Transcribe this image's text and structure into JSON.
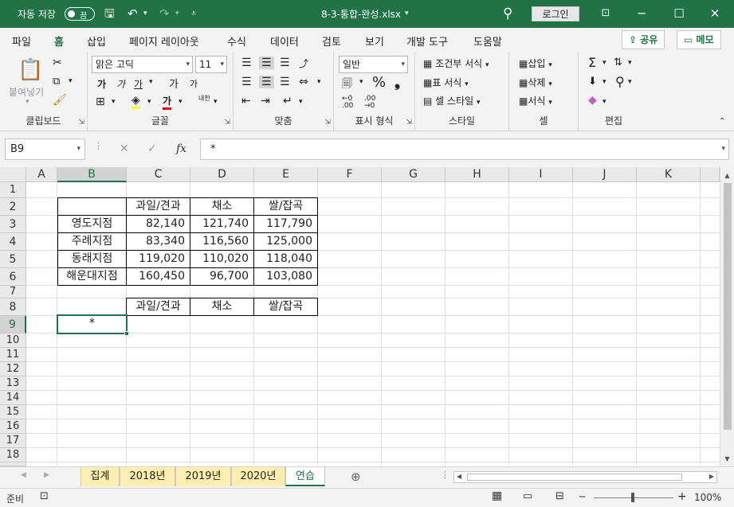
{
  "titlebar": {
    "autosave_label": "자동 저장",
    "autosave_state": "끔",
    "filename": "8-3-통합-완성.xlsx",
    "login_label": "로그인"
  },
  "menu": {
    "items": [
      "파일",
      "홈",
      "삽입",
      "페이지 레이아웃",
      "수식",
      "데이터",
      "검토",
      "보기",
      "개발 도구",
      "도움말"
    ],
    "active": "홈",
    "share_label": "공유",
    "memo_label": "메모"
  },
  "ribbon": {
    "clipboard": {
      "label": "클립보드",
      "paste": "붙여넣기"
    },
    "font": {
      "label": "글꼴",
      "name": "맑은 고딕",
      "size": "11",
      "bold": "가",
      "italic": "가",
      "underline": "가",
      "grow": "가",
      "shrink": "가",
      "fontcolor_glyph": "가",
      "phonetic": "내천"
    },
    "alignment": {
      "label": "맞춤"
    },
    "number": {
      "label": "표시 형식",
      "format": "일반"
    },
    "styles": {
      "label": "스타일",
      "conditional": "조건부 서식",
      "table": "표 서식",
      "cell": "셀 스타일"
    },
    "cells": {
      "label": "셀",
      "insert": "삽입",
      "delete": "삭제",
      "format": "서식"
    },
    "editing": {
      "label": "편집"
    }
  },
  "formula_bar": {
    "name_box": "B9",
    "formula": "*"
  },
  "sheet": {
    "columns": [
      "A",
      "B",
      "C",
      "D",
      "E",
      "F",
      "G",
      "H",
      "I",
      "J",
      "K"
    ],
    "selected_column": "B",
    "rows": [
      "1",
      "2",
      "3",
      "4",
      "5",
      "6",
      "7",
      "8",
      "9",
      "10",
      "11",
      "12",
      "13",
      "14",
      "15",
      "16",
      "17",
      "18"
    ],
    "selected_row": "9",
    "header_row": [
      "과일/견과",
      "채소",
      "쌀/잡곡"
    ],
    "data_rows": [
      {
        "label": "영도지점",
        "values": [
          "82,140",
          "121,740",
          "117,790"
        ]
      },
      {
        "label": "주례지점",
        "values": [
          "83,340",
          "116,560",
          "125,000"
        ]
      },
      {
        "label": "동래지점",
        "values": [
          "119,020",
          "110,020",
          "118,040"
        ]
      },
      {
        "label": "해운대지점",
        "values": [
          "160,450",
          "96,700",
          "103,080"
        ]
      }
    ],
    "summary_header": [
      "과일/견과",
      "채소",
      "쌀/잡곡"
    ],
    "active_cell_value": "*"
  },
  "tabs": {
    "items": [
      "집계",
      "2018년",
      "2019년",
      "2020년",
      "연습"
    ],
    "active": "연습"
  },
  "status": {
    "ready": "준비",
    "zoom": "100%"
  },
  "colors": {
    "accent": "#217346",
    "tab_fill": "#ffeeb0"
  }
}
